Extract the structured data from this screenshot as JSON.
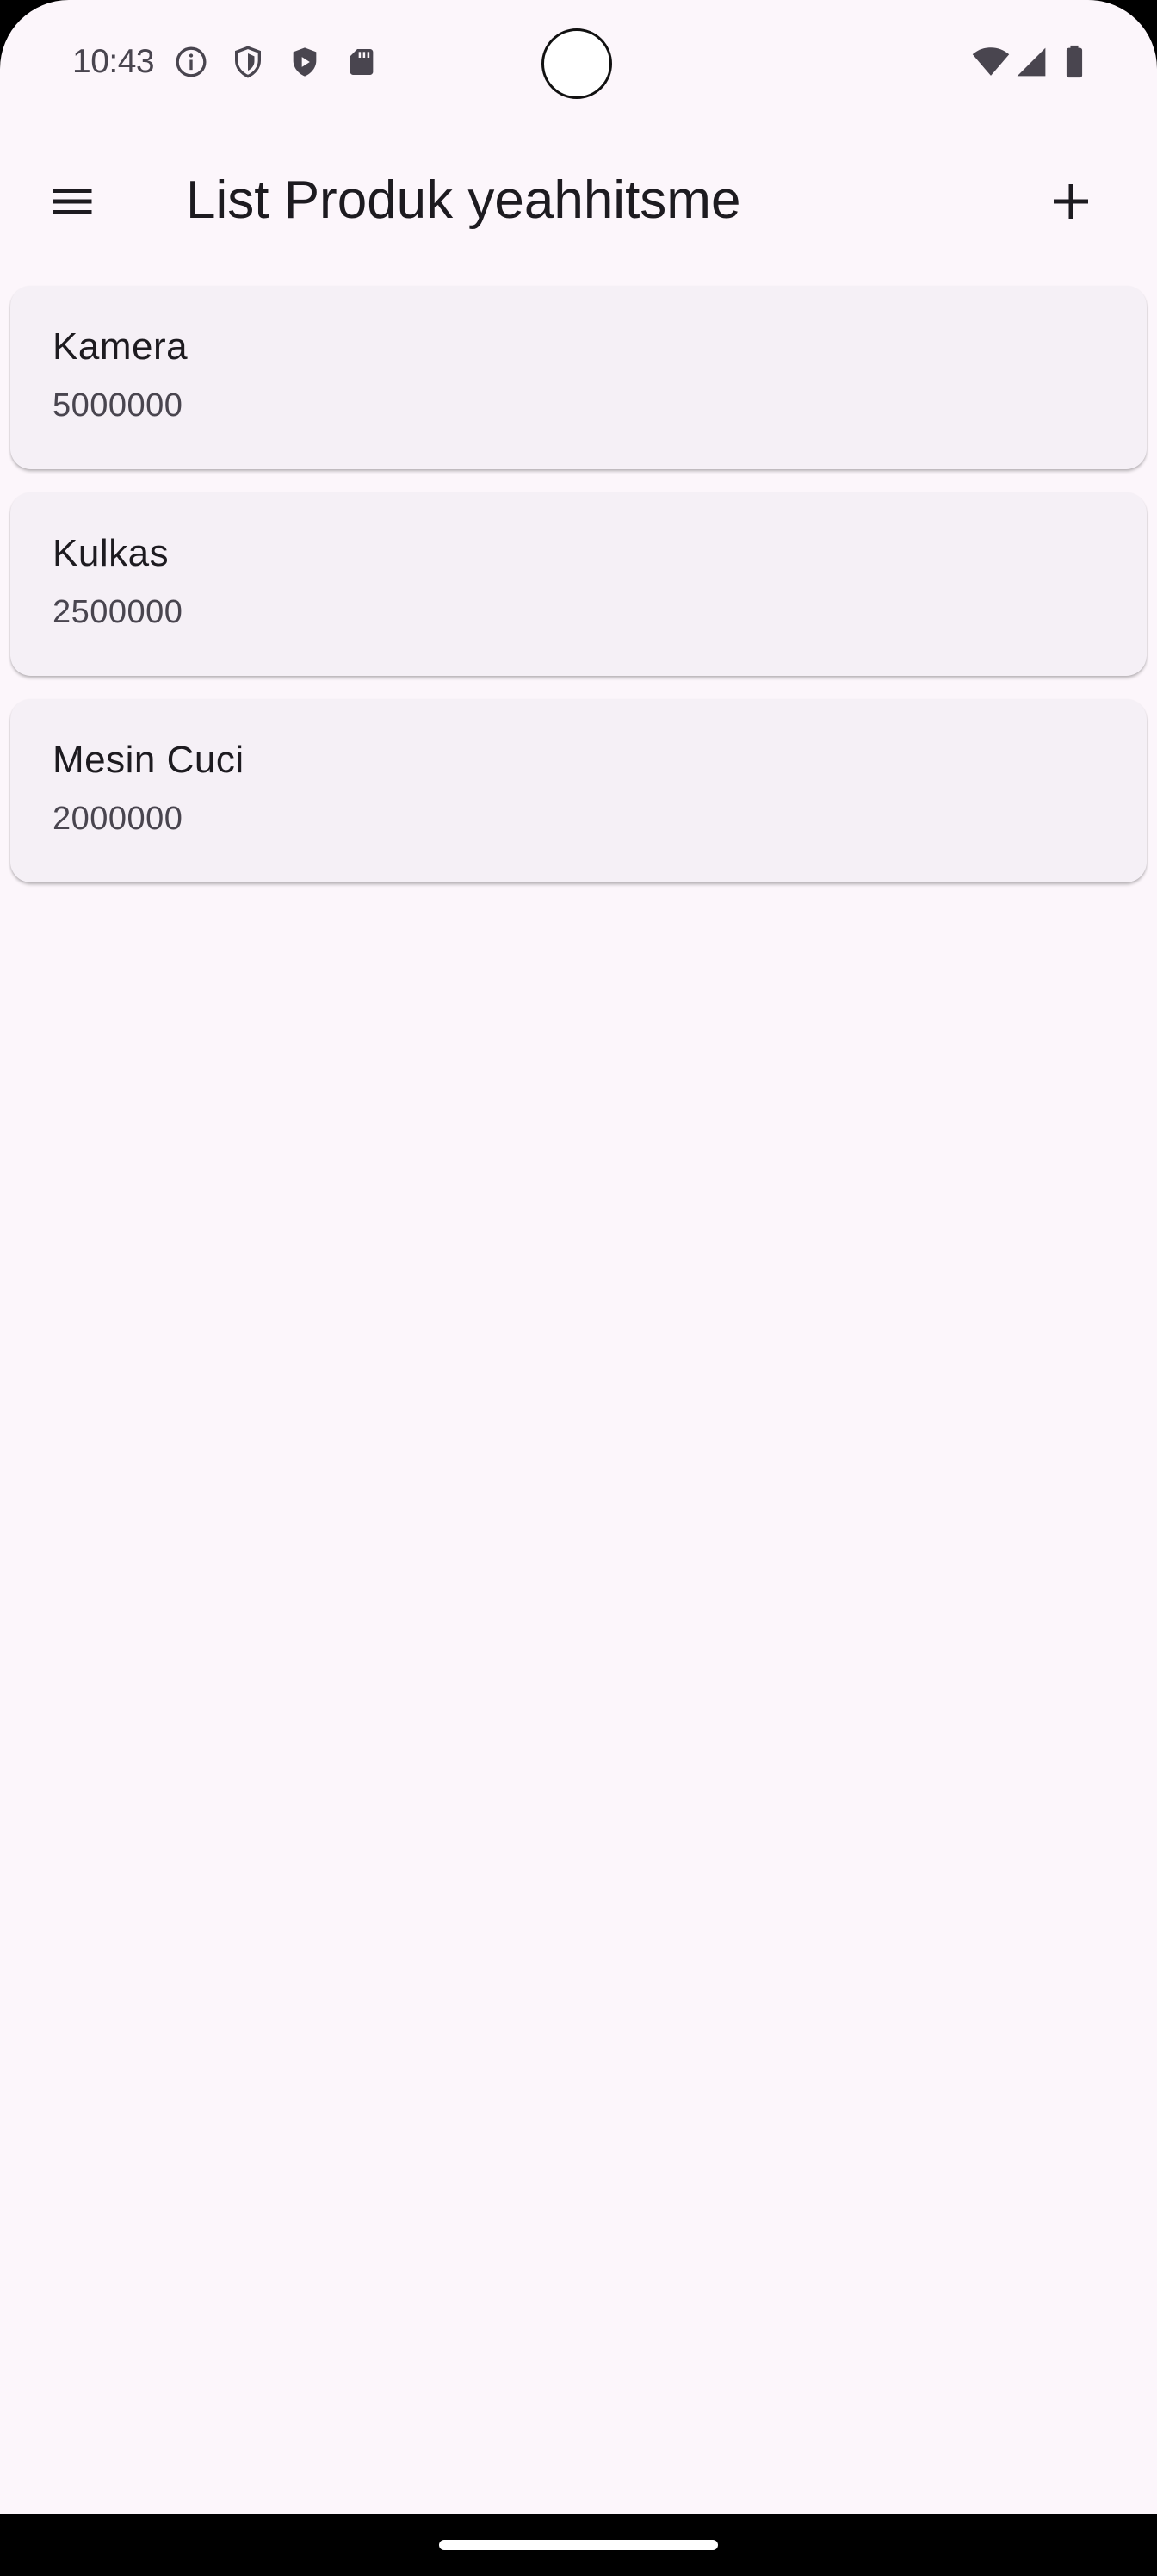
{
  "status_bar": {
    "time": "10:43",
    "icons": [
      "info-icon",
      "shield-icon",
      "play-shield-icon",
      "sd-card-icon",
      "wifi-icon",
      "signal-icon",
      "battery-icon"
    ]
  },
  "app_bar": {
    "title": "List Produk yeahhitsme",
    "menu_icon": "menu-icon",
    "add_icon": "add-icon"
  },
  "products": [
    {
      "name": "Kamera",
      "price": "5000000"
    },
    {
      "name": "Kulkas",
      "price": "2500000"
    },
    {
      "name": "Mesin Cuci",
      "price": "2000000"
    }
  ],
  "colors": {
    "background": "#fcf6fb",
    "card": "#f5f0f6",
    "text_primary": "#1d1b20",
    "text_secondary": "#49454f"
  }
}
